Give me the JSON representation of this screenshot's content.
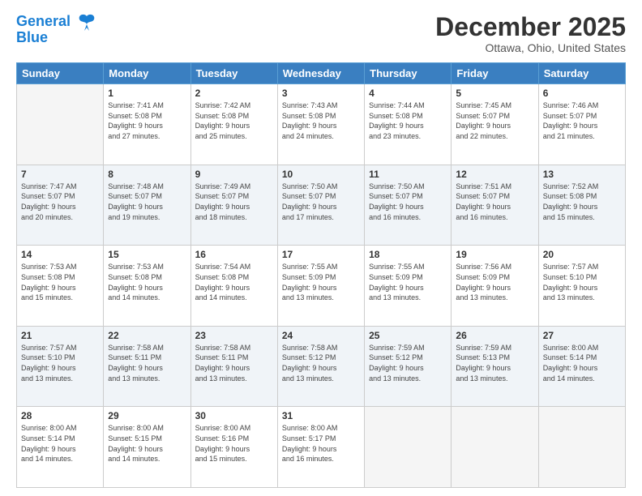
{
  "header": {
    "logo_line1": "General",
    "logo_line2": "Blue",
    "title": "December 2025",
    "subtitle": "Ottawa, Ohio, United States"
  },
  "weekdays": [
    "Sunday",
    "Monday",
    "Tuesday",
    "Wednesday",
    "Thursday",
    "Friday",
    "Saturday"
  ],
  "weeks": [
    [
      {
        "date": "",
        "info": ""
      },
      {
        "date": "1",
        "info": "Sunrise: 7:41 AM\nSunset: 5:08 PM\nDaylight: 9 hours\nand 27 minutes."
      },
      {
        "date": "2",
        "info": "Sunrise: 7:42 AM\nSunset: 5:08 PM\nDaylight: 9 hours\nand 25 minutes."
      },
      {
        "date": "3",
        "info": "Sunrise: 7:43 AM\nSunset: 5:08 PM\nDaylight: 9 hours\nand 24 minutes."
      },
      {
        "date": "4",
        "info": "Sunrise: 7:44 AM\nSunset: 5:08 PM\nDaylight: 9 hours\nand 23 minutes."
      },
      {
        "date": "5",
        "info": "Sunrise: 7:45 AM\nSunset: 5:07 PM\nDaylight: 9 hours\nand 22 minutes."
      },
      {
        "date": "6",
        "info": "Sunrise: 7:46 AM\nSunset: 5:07 PM\nDaylight: 9 hours\nand 21 minutes."
      }
    ],
    [
      {
        "date": "7",
        "info": "Sunrise: 7:47 AM\nSunset: 5:07 PM\nDaylight: 9 hours\nand 20 minutes."
      },
      {
        "date": "8",
        "info": "Sunrise: 7:48 AM\nSunset: 5:07 PM\nDaylight: 9 hours\nand 19 minutes."
      },
      {
        "date": "9",
        "info": "Sunrise: 7:49 AM\nSunset: 5:07 PM\nDaylight: 9 hours\nand 18 minutes."
      },
      {
        "date": "10",
        "info": "Sunrise: 7:50 AM\nSunset: 5:07 PM\nDaylight: 9 hours\nand 17 minutes."
      },
      {
        "date": "11",
        "info": "Sunrise: 7:50 AM\nSunset: 5:07 PM\nDaylight: 9 hours\nand 16 minutes."
      },
      {
        "date": "12",
        "info": "Sunrise: 7:51 AM\nSunset: 5:07 PM\nDaylight: 9 hours\nand 16 minutes."
      },
      {
        "date": "13",
        "info": "Sunrise: 7:52 AM\nSunset: 5:08 PM\nDaylight: 9 hours\nand 15 minutes."
      }
    ],
    [
      {
        "date": "14",
        "info": "Sunrise: 7:53 AM\nSunset: 5:08 PM\nDaylight: 9 hours\nand 15 minutes."
      },
      {
        "date": "15",
        "info": "Sunrise: 7:53 AM\nSunset: 5:08 PM\nDaylight: 9 hours\nand 14 minutes."
      },
      {
        "date": "16",
        "info": "Sunrise: 7:54 AM\nSunset: 5:08 PM\nDaylight: 9 hours\nand 14 minutes."
      },
      {
        "date": "17",
        "info": "Sunrise: 7:55 AM\nSunset: 5:09 PM\nDaylight: 9 hours\nand 13 minutes."
      },
      {
        "date": "18",
        "info": "Sunrise: 7:55 AM\nSunset: 5:09 PM\nDaylight: 9 hours\nand 13 minutes."
      },
      {
        "date": "19",
        "info": "Sunrise: 7:56 AM\nSunset: 5:09 PM\nDaylight: 9 hours\nand 13 minutes."
      },
      {
        "date": "20",
        "info": "Sunrise: 7:57 AM\nSunset: 5:10 PM\nDaylight: 9 hours\nand 13 minutes."
      }
    ],
    [
      {
        "date": "21",
        "info": "Sunrise: 7:57 AM\nSunset: 5:10 PM\nDaylight: 9 hours\nand 13 minutes."
      },
      {
        "date": "22",
        "info": "Sunrise: 7:58 AM\nSunset: 5:11 PM\nDaylight: 9 hours\nand 13 minutes."
      },
      {
        "date": "23",
        "info": "Sunrise: 7:58 AM\nSunset: 5:11 PM\nDaylight: 9 hours\nand 13 minutes."
      },
      {
        "date": "24",
        "info": "Sunrise: 7:58 AM\nSunset: 5:12 PM\nDaylight: 9 hours\nand 13 minutes."
      },
      {
        "date": "25",
        "info": "Sunrise: 7:59 AM\nSunset: 5:12 PM\nDaylight: 9 hours\nand 13 minutes."
      },
      {
        "date": "26",
        "info": "Sunrise: 7:59 AM\nSunset: 5:13 PM\nDaylight: 9 hours\nand 13 minutes."
      },
      {
        "date": "27",
        "info": "Sunrise: 8:00 AM\nSunset: 5:14 PM\nDaylight: 9 hours\nand 14 minutes."
      }
    ],
    [
      {
        "date": "28",
        "info": "Sunrise: 8:00 AM\nSunset: 5:14 PM\nDaylight: 9 hours\nand 14 minutes."
      },
      {
        "date": "29",
        "info": "Sunrise: 8:00 AM\nSunset: 5:15 PM\nDaylight: 9 hours\nand 14 minutes."
      },
      {
        "date": "30",
        "info": "Sunrise: 8:00 AM\nSunset: 5:16 PM\nDaylight: 9 hours\nand 15 minutes."
      },
      {
        "date": "31",
        "info": "Sunrise: 8:00 AM\nSunset: 5:17 PM\nDaylight: 9 hours\nand 16 minutes."
      },
      {
        "date": "",
        "info": ""
      },
      {
        "date": "",
        "info": ""
      },
      {
        "date": "",
        "info": ""
      }
    ]
  ]
}
